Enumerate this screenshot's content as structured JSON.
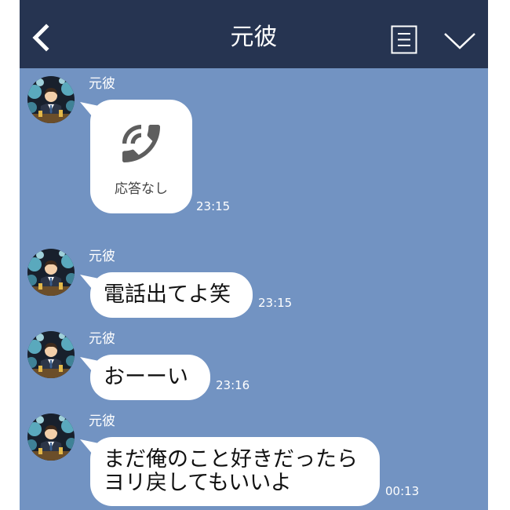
{
  "header": {
    "title": "元彼",
    "back_icon": "chevron-left-icon",
    "menu_icon": "list-icon",
    "expand_icon": "chevron-down-icon"
  },
  "messages": [
    {
      "sender": "元彼",
      "icon": "phone-call-icon",
      "text": "応答なし",
      "time": "23:15"
    },
    {
      "sender": "元彼",
      "text": "電話出てよ笑",
      "time": "23:15"
    },
    {
      "sender": "元彼",
      "text": "おーーい",
      "time": "23:16"
    },
    {
      "sender": "元彼",
      "lines": [
        "まだ俺のこと好きだったら",
        "ヨリ戻してもいいよ"
      ],
      "time": "00:13"
    }
  ],
  "colors": {
    "header_bg": "#263451",
    "chat_bg": "#7293c2",
    "bubble_bg": "#ffffff",
    "call_icon": "#5e5e5e",
    "text": "#111111",
    "meta_text": "#ffffff"
  }
}
